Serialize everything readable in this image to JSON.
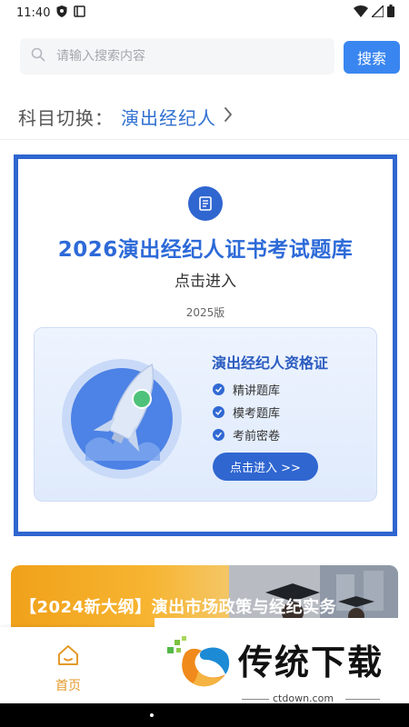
{
  "status_bar": {
    "time": "11:40"
  },
  "search": {
    "placeholder": "请输入搜索内容",
    "button_label": "搜索"
  },
  "subject": {
    "label": "科目切换：",
    "value": "演出经纪人"
  },
  "banner": {
    "title": "2026演出经纪人证书考试题库",
    "subtitle": "点击进入",
    "version": "2025版",
    "card": {
      "title": "演出经纪人资格证",
      "items": [
        "精讲题库",
        "模考题库",
        "考前密卷"
      ],
      "button_label": "点击进入 >>"
    }
  },
  "course_banner": {
    "title": "【2024新大纲】演出市场政策与经纪实务"
  },
  "tabbar": {
    "home_label": "首页"
  },
  "watermark": {
    "brand": "传统下载",
    "url": "ctdown.com"
  },
  "colors": {
    "primary": "#3a86f0",
    "banner_border": "#2f66d0",
    "active_tab": "#e39a2b"
  },
  "icons": [
    "shield-icon",
    "square-icon",
    "wifi-icon",
    "signal-icon",
    "battery-icon",
    "search-icon",
    "chevron-right-icon",
    "document-icon",
    "check-icon",
    "rocket-icon",
    "home-icon"
  ]
}
